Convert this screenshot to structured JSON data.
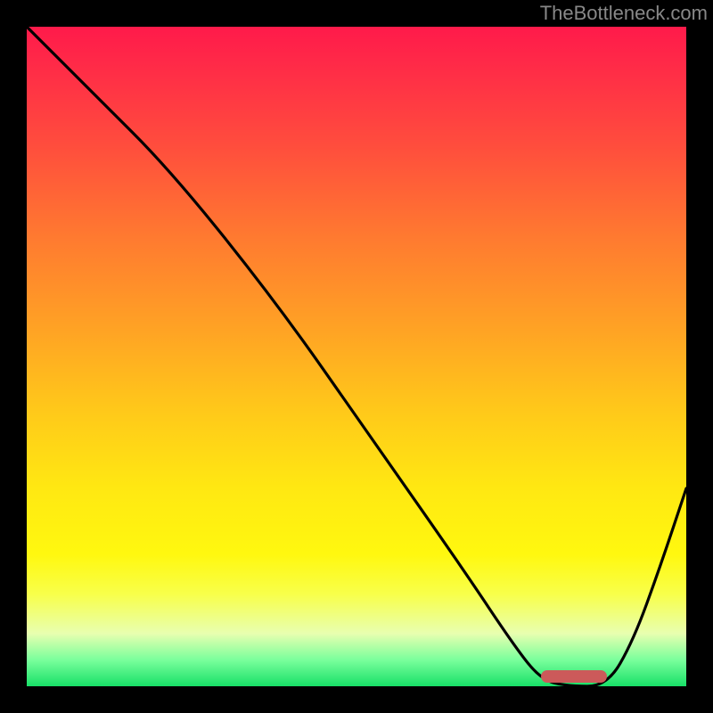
{
  "watermark": "TheBottleneck.com",
  "chart_data": {
    "type": "line",
    "title": "",
    "xlabel": "",
    "ylabel": "",
    "xlim": [
      0,
      100
    ],
    "ylim": [
      0,
      100
    ],
    "x": [
      0,
      10,
      22,
      38,
      52,
      66,
      74,
      78,
      82,
      88,
      92,
      96,
      100
    ],
    "values": [
      100,
      90,
      78,
      58,
      38,
      18,
      6,
      1,
      0,
      0,
      7,
      18,
      30
    ],
    "optimal_range": {
      "start": 78,
      "end": 88,
      "y": 0.5
    },
    "gradient_stops": [
      {
        "pct": 0,
        "color": "#ff1a4a"
      },
      {
        "pct": 50,
        "color": "#ffc020"
      },
      {
        "pct": 85,
        "color": "#fcff40"
      },
      {
        "pct": 100,
        "color": "#18e068"
      }
    ]
  }
}
